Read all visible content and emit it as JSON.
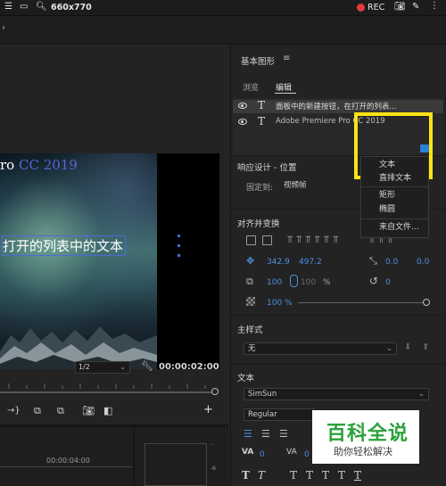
{
  "topbar": {
    "size_label": "660x770",
    "rec_label": "REC"
  },
  "preview": {
    "line1_prefix": "ro",
    "line1_suffix": "CC 2019",
    "line2": "打开的列表中的文本"
  },
  "timeline": {
    "zoom": "1/2",
    "timecode": "00:00:02:00",
    "ruler_time": "00:00:04:00"
  },
  "panel": {
    "title": "基本图形",
    "tabs": [
      "浏览",
      "编辑"
    ],
    "layers": [
      "面板中的新建按钮，在打开的列表...",
      "Adobe Premiere Pro CC 2019"
    ],
    "responsive": {
      "title": "响应设计 - 位置",
      "pin_label": "固定到:",
      "pin_value": "视频帧"
    },
    "align": {
      "title": "对齐并变换",
      "pos_x": "342.9",
      "pos_y": "497.2",
      "anchor_x": "0.0",
      "anchor_y": "0.0",
      "scale_w": "100",
      "scale_h": "100",
      "scale_unit": "%",
      "rotation": "0",
      "opacity": "100 %"
    },
    "master_style": {
      "title": "主样式",
      "value": "无"
    },
    "text": {
      "title": "文本",
      "font": "SimSun",
      "style": "Regular",
      "tracking": "0",
      "kerning": "0"
    }
  },
  "menu": {
    "items": [
      "文本",
      "直排文本",
      "矩形",
      "椭圆",
      "来自文件..."
    ]
  },
  "watermark": {
    "big": "百科全说",
    "small": "助你轻松解决"
  }
}
